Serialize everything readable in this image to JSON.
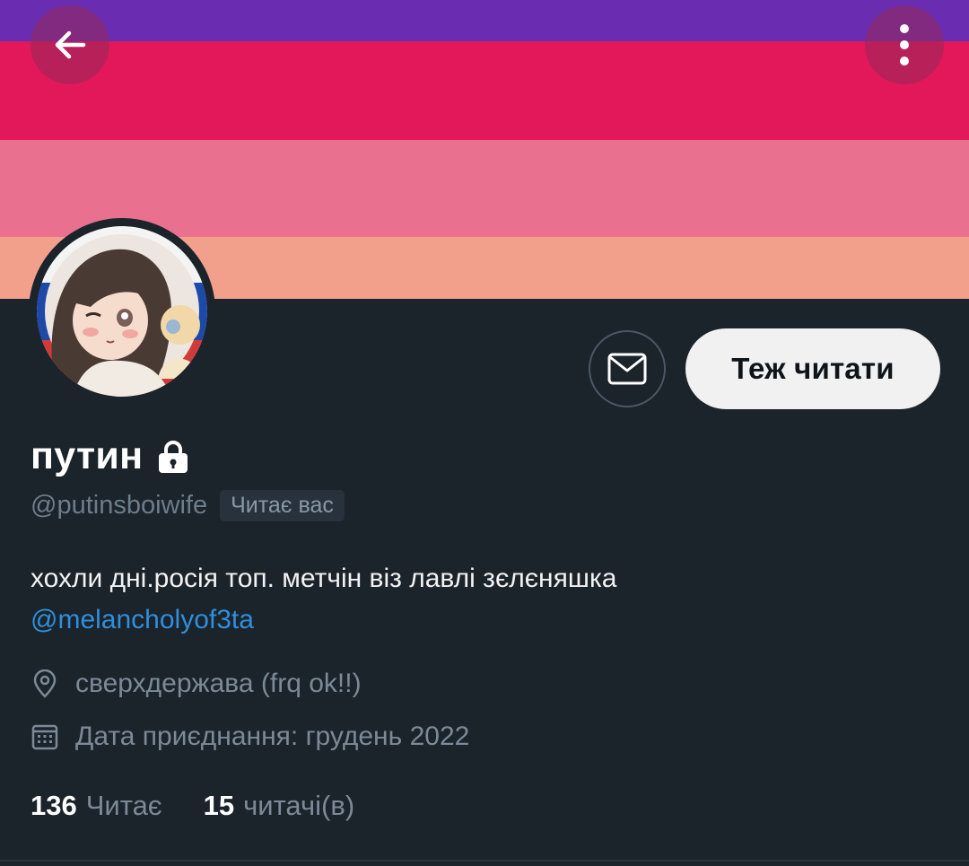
{
  "banner": {
    "stripes": [
      "#6a2cb0",
      "#e3185a",
      "#e9708e",
      "#f2a08c"
    ]
  },
  "header": {
    "back_icon": "arrow-left-icon",
    "more_icon": "more-vertical-icon"
  },
  "actions": {
    "message_icon": "envelope-icon",
    "follow_label": "Теж читати"
  },
  "profile": {
    "name": "путин",
    "protected_icon": "lock-icon",
    "handle": "@putinsboiwife",
    "follows_you": "Читає вас",
    "bio": "хохли дні.росія топ. метчін віз лавлі зєлєняшка",
    "bio_mention": "@melancholyof3ta",
    "location_icon": "location-pin-icon",
    "location": "сверхдержава (frq ok!!)",
    "joined_icon": "calendar-icon",
    "joined": "Дата приєднання: грудень 2022",
    "following_count": "136",
    "following_label": "Читає",
    "followers_count": "15",
    "followers_label": "читачі(в)"
  },
  "colors": {
    "background": "#1b232b",
    "link": "#2f8fdc",
    "muted": "#7c8a97"
  }
}
